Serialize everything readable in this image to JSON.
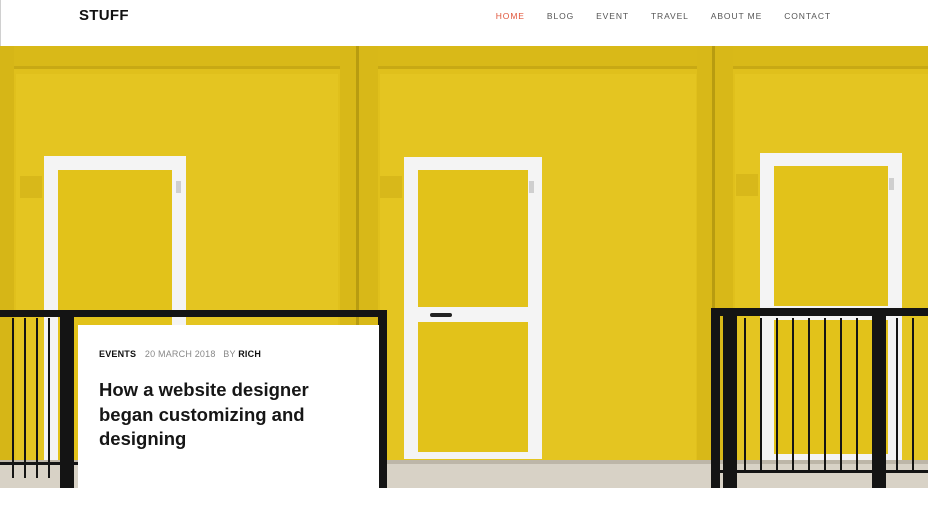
{
  "site": {
    "logo": "STUFF"
  },
  "nav": {
    "items": [
      {
        "label": "HOME",
        "active": true
      },
      {
        "label": "BLOG",
        "active": false
      },
      {
        "label": "EVENT",
        "active": false
      },
      {
        "label": "TRAVEL",
        "active": false
      },
      {
        "label": "ABOUT ME",
        "active": false
      },
      {
        "label": "CONTACT",
        "active": false
      }
    ],
    "active_color": "#e0563b"
  },
  "post": {
    "category": "EVENTS",
    "date": "20 MARCH 2018",
    "by_label": "BY",
    "author": "RICH",
    "title": "How a website designer began customizing and designing"
  },
  "colors": {
    "wall_yellow": "#e2c21a",
    "rail_black": "#141414"
  }
}
